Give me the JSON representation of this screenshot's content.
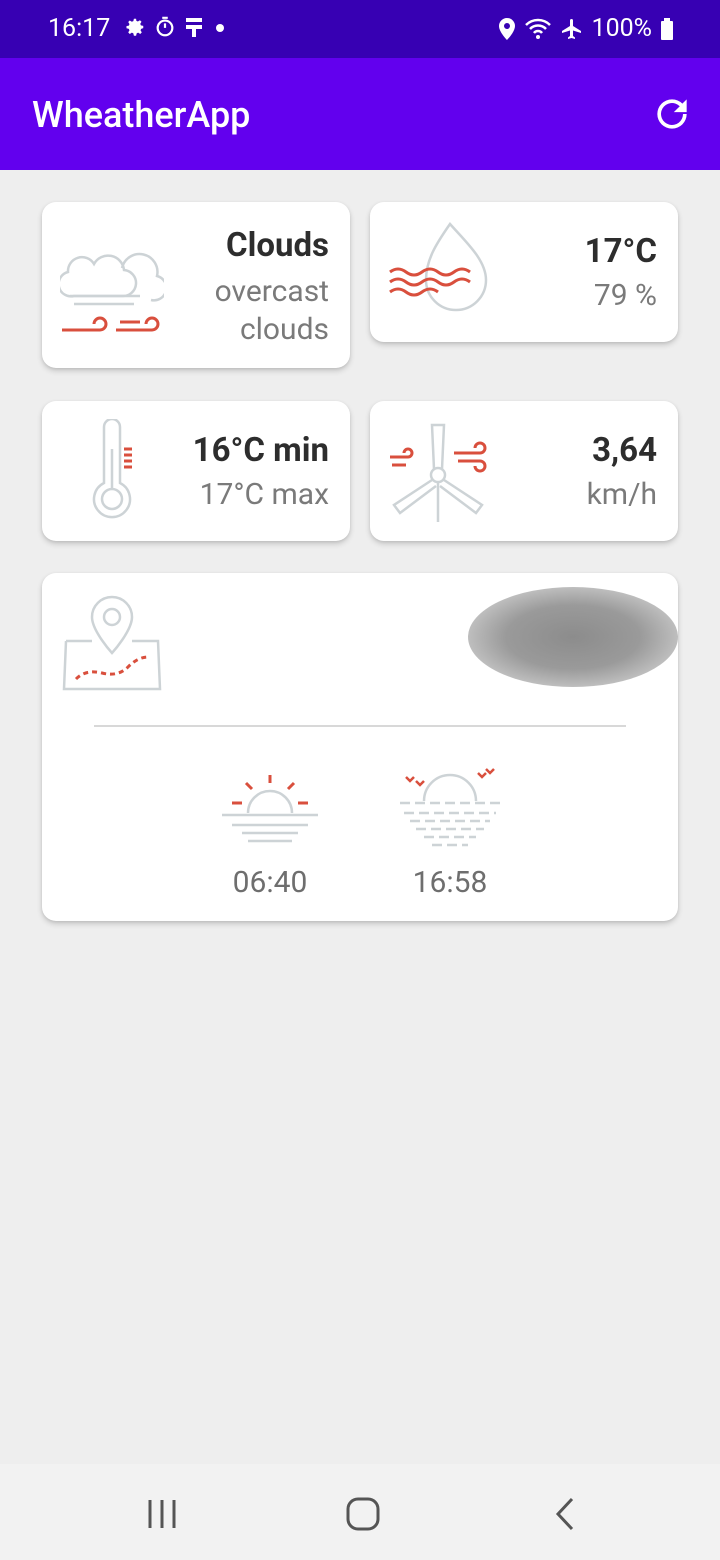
{
  "status": {
    "time": "16:17",
    "battery": "100%"
  },
  "app": {
    "title": "WheatherApp"
  },
  "weather": {
    "main": "Clouds",
    "description_line1": "overcast",
    "description_line2": "clouds"
  },
  "humidity": {
    "temp": "17°C",
    "percent": "79 %"
  },
  "temperature": {
    "min": "16°C min",
    "max": "17°C max"
  },
  "wind": {
    "speed": "3,64",
    "unit": "km/h"
  },
  "sun": {
    "sunrise": "06:40",
    "sunset": "16:58"
  },
  "colors": {
    "status_bar": "#3700b3",
    "app_bar": "#6200ee",
    "accent_red": "#d94f3d",
    "icon_gray": "#cdd3d6"
  }
}
